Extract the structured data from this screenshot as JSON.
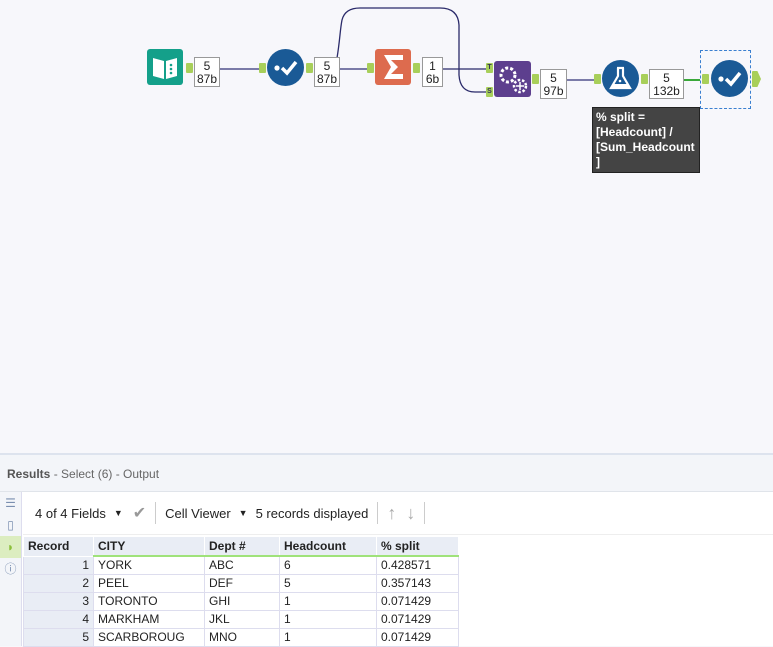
{
  "workflow": {
    "counts": [
      {
        "records": "5",
        "bytes": "87b"
      },
      {
        "records": "5",
        "bytes": "87b"
      },
      {
        "records": "1",
        "bytes": "6b"
      },
      {
        "records": "5",
        "bytes": "97b"
      },
      {
        "records": "5",
        "bytes": "132b"
      }
    ],
    "append_anchors": {
      "target": "T",
      "source": "S"
    },
    "tooltip": "% split = [Headcount] / [Sum_Headcount ]"
  },
  "results": {
    "title": "Results",
    "subtitle": " - Select (6) - Output",
    "fields_label": "4 of 4 Fields",
    "viewer_label": "Cell Viewer",
    "records_displayed": "5 records displayed",
    "columns": [
      "Record",
      "CITY",
      "Dept #",
      "Headcount",
      "% split"
    ],
    "rows": [
      [
        "1",
        "YORK",
        "ABC",
        "6",
        "0.428571"
      ],
      [
        "2",
        "PEEL",
        "DEF",
        "5",
        "0.357143"
      ],
      [
        "3",
        "TORONTO",
        "GHI",
        "1",
        "0.071429"
      ],
      [
        "4",
        "MARKHAM",
        "JKL",
        "1",
        "0.071429"
      ],
      [
        "5",
        "SCARBOROUG",
        "MNO",
        "1",
        "0.071429"
      ]
    ]
  }
}
